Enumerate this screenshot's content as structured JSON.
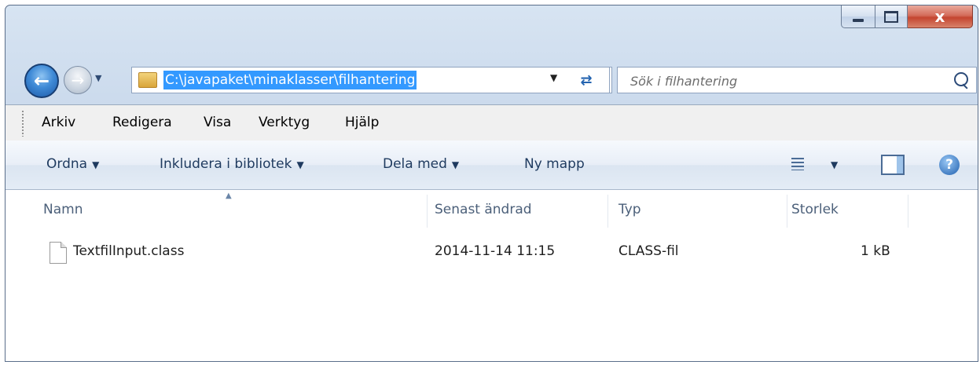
{
  "window": {
    "caption_minimize": "–",
    "caption_maximize": "",
    "caption_close": "x"
  },
  "nav": {
    "back_glyph": "←",
    "forward_glyph": "→",
    "address_path": "C:\\javapaket\\minaklasser\\filhantering",
    "refresh_glyph": "⇄"
  },
  "search": {
    "placeholder": "Sök i filhantering"
  },
  "menubar": {
    "items": [
      "Arkiv",
      "Redigera",
      "Visa",
      "Verktyg",
      "Hjälp"
    ]
  },
  "commandbar": {
    "items": [
      "Ordna",
      "Inkludera i bibliotek",
      "Dela med",
      "Ny mapp"
    ],
    "help_glyph": "?"
  },
  "columns": [
    "Namn",
    "Senast ändrad",
    "Typ",
    "Storlek"
  ],
  "files": [
    {
      "name": "TextfilInput.class",
      "modified": "2014-11-14 11:15",
      "type": "CLASS-fil",
      "size": "1 kB"
    }
  ],
  "icons": {
    "back": "back-arrow-icon",
    "forward": "forward-arrow-icon",
    "folder": "folder-icon",
    "refresh": "refresh-icon",
    "search": "search-icon",
    "views": "views-icon",
    "preview_pane": "preview-pane-icon",
    "help": "help-icon",
    "file": "file-icon"
  },
  "colors": {
    "selection": "#3399ff",
    "close_button": "#c44530",
    "window_frame": "#c6d6ea"
  }
}
